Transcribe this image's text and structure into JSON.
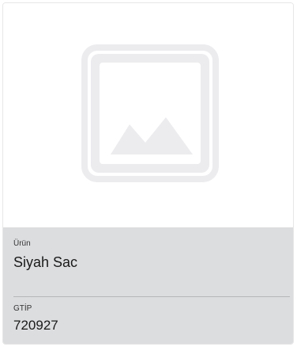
{
  "image": {
    "icon": "image-placeholder-icon"
  },
  "product": {
    "label": "Ürün",
    "value": "Siyah Sac"
  },
  "gtip": {
    "label": "GTİP",
    "value": "720927"
  },
  "colors": {
    "info_background": "#dcdddf",
    "placeholder": "#ececef"
  }
}
